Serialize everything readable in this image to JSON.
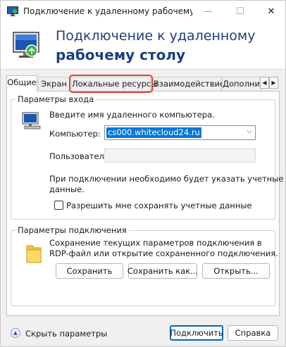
{
  "window": {
    "title": "Подключение к удаленному рабочему сто...",
    "minimize_glyph": "—",
    "maximize_glyph": "☐",
    "close_glyph": "✕"
  },
  "banner": {
    "line1": "Подключение к удаленному",
    "line2": "рабочему столу"
  },
  "tabs": [
    {
      "label": "Общие",
      "active": true
    },
    {
      "label": "Экран"
    },
    {
      "label": "Локальные ресурсы",
      "highlighted": true
    },
    {
      "label": "Взаимодействие"
    },
    {
      "label": "Дополнит"
    }
  ],
  "tab_scroll": {
    "left": "◀",
    "right": "▶"
  },
  "login_group": {
    "title": "Параметры входа",
    "prompt": "Введите имя удаленного компьютера.",
    "computer_label": "Компьютер:",
    "computer_value": "cs000.whitecloud24.ru",
    "user_label": "Пользователь:",
    "user_value": "",
    "note_line1": "При подключении необходимо будет указать учетные",
    "note_line2": "данные.",
    "save_creds_label": "Разрешить мне сохранять учетные данные",
    "save_creds_checked": false
  },
  "connection_group": {
    "title": "Параметры подключения",
    "desc_line1": "Сохранение текущих параметров подключения в",
    "desc_line2": "RDP-файл или открытие сохраненного подключения.",
    "save_button": "Сохранить",
    "save_as_button": "Сохранить как...",
    "open_button": "Открыть..."
  },
  "footer": {
    "hide_options": "Скрыть параметры",
    "connect_button": "Подключить",
    "help_button": "Справка"
  },
  "colors": {
    "accent": "#0078d7",
    "banner_text": "#1e3f7c",
    "highlight_outline": "#e0403c"
  }
}
